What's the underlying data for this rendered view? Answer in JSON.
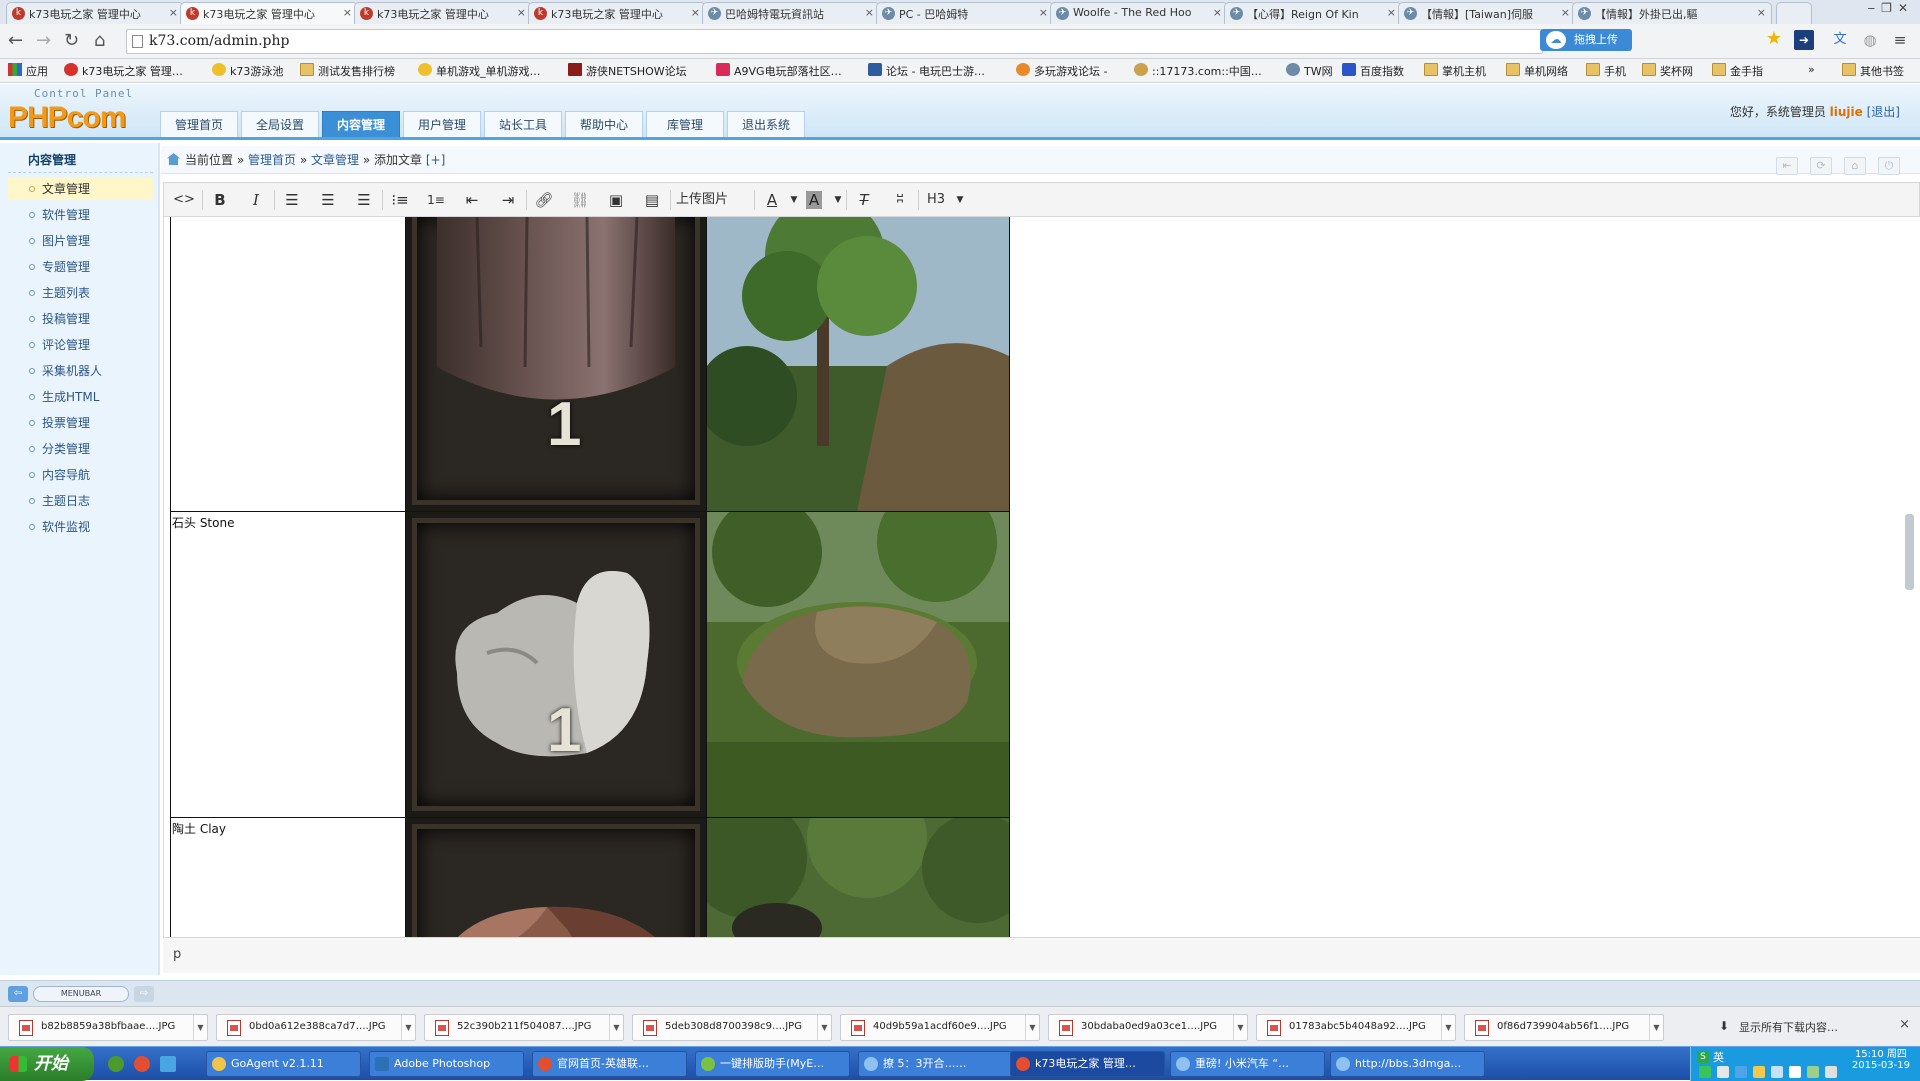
{
  "browser": {
    "tabs": [
      {
        "title": "k73电玩之家 管理中心",
        "favicon": "k73-red"
      },
      {
        "title": "k73电玩之家 管理中心",
        "favicon": "k73-red",
        "active": true
      },
      {
        "title": "k73电玩之家 管理中心",
        "favicon": "k73-red"
      },
      {
        "title": "k73电玩之家 管理中心",
        "favicon": "k73-red"
      },
      {
        "title": "巴哈姆特電玩資訊站",
        "favicon": "bahamut"
      },
      {
        "title": "PC - 巴哈姆特",
        "favicon": "bahamut"
      },
      {
        "title": "Woolfe - The Red Hoo",
        "favicon": "bahamut"
      },
      {
        "title": "【心得】Reign Of Kin",
        "favicon": "bahamut"
      },
      {
        "title": "【情報】[Taiwan]伺服",
        "favicon": "bahamut"
      },
      {
        "title": "【情報】外掛已出,驅",
        "favicon": "bahamut"
      }
    ],
    "url": "k73.com/admin.php",
    "upload_ext_label": "拖拽上传",
    "bookmarks": [
      {
        "label": "应用",
        "icon": "grid"
      },
      {
        "label": "k73电玩之家 管理…",
        "icon": "site"
      },
      {
        "label": "k73游泳池",
        "icon": "site"
      },
      {
        "label": "测试发售排行榜",
        "icon": "folder"
      },
      {
        "label": "单机游戏_单机游戏…",
        "icon": "site"
      },
      {
        "label": "游侠NETSHOW论坛",
        "icon": "site"
      },
      {
        "label": "A9VG电玩部落社区…",
        "icon": "site"
      },
      {
        "label": "论坛 - 电玩巴士游…",
        "icon": "site"
      },
      {
        "label": "多玩游戏论坛 -",
        "icon": "site"
      },
      {
        "label": "::17173.com::中国…",
        "icon": "site"
      },
      {
        "label": "TW网",
        "icon": "site"
      },
      {
        "label": "百度指数",
        "icon": "site"
      },
      {
        "label": "掌机主机",
        "icon": "folder"
      },
      {
        "label": "单机网络",
        "icon": "folder"
      },
      {
        "label": "手机",
        "icon": "folder"
      },
      {
        "label": "奖杯网",
        "icon": "folder"
      },
      {
        "label": "金手指",
        "icon": "folder"
      },
      {
        "label": "»",
        "icon": "none"
      },
      {
        "label": "其他书签",
        "icon": "folder"
      }
    ]
  },
  "app": {
    "control_panel_label": "Control Panel",
    "logo": "PHPcom",
    "nav": [
      "管理首页",
      "全局设置",
      "内容管理",
      "用户管理",
      "站长工具",
      "帮助中心",
      "库管理",
      "退出系统"
    ],
    "active_nav": 2,
    "welcome_prefix": "您好，系统管理员",
    "username": "liujie",
    "logout": "[退出]"
  },
  "sidebar": {
    "title": "内容管理",
    "items": [
      "文章管理",
      "软件管理",
      "图片管理",
      "专题管理",
      "主题列表",
      "投稿管理",
      "评论管理",
      "采集机器人",
      "生成HTML",
      "投票管理",
      "分类管理",
      "内容导航",
      "主题日志",
      "软件监视"
    ],
    "active_index": 0
  },
  "breadcrumb": {
    "prefix": "当前位置 »",
    "home": "管理首页",
    "sep1": "»",
    "section": "文章管理",
    "sep2": "»",
    "page": "添加文章",
    "extra": "[+]"
  },
  "editor": {
    "toolbar": {
      "source": "<>",
      "bold": "B",
      "italic": "I",
      "upload_image": "上传图片",
      "font_color": "A",
      "bg_color": "A",
      "heading": "H3"
    },
    "rows": [
      {
        "label": "",
        "icon": "wood",
        "qty": "1",
        "scene": "tree"
      },
      {
        "label": "石头 Stone",
        "icon": "stone",
        "qty": "1",
        "scene": "boulder"
      },
      {
        "label": "陶土 Clay",
        "icon": "clay",
        "qty": "",
        "scene": "clay-rocks"
      }
    ],
    "status_path": "p"
  },
  "menubar": {
    "label": "MENUBAR"
  },
  "downloads": {
    "items": [
      "b82b8859a38bfbaae….JPG",
      "0bd0a612e388ca7d7….JPG",
      "52c390b211f504087….JPG",
      "5deb308d8700398c9….JPG",
      "40d9b59a1acdf60e9….JPG",
      "30bdaba0ed9a03ce1….JPG",
      "01783abc5b4048a92….JPG",
      "0f86d739904ab56f1….JPG"
    ],
    "show_all": "显示所有下载内容…"
  },
  "taskbar": {
    "start": "开始",
    "tasks": [
      {
        "label": "GoAgent v2.1.11"
      },
      {
        "label": "Adobe Photoshop"
      },
      {
        "label": "官网首页-英雄联…"
      },
      {
        "label": "一键排版助手(MyE…"
      },
      {
        "label": "撩 5：3开合……"
      },
      {
        "label": "k73电玩之家 管理…",
        "active": true
      },
      {
        "label": "重磅! 小米汽车 “…"
      },
      {
        "label": "http://bbs.3dmga…"
      }
    ],
    "ime": "英",
    "time": "15:10 周四",
    "date": "2015-03-19"
  }
}
